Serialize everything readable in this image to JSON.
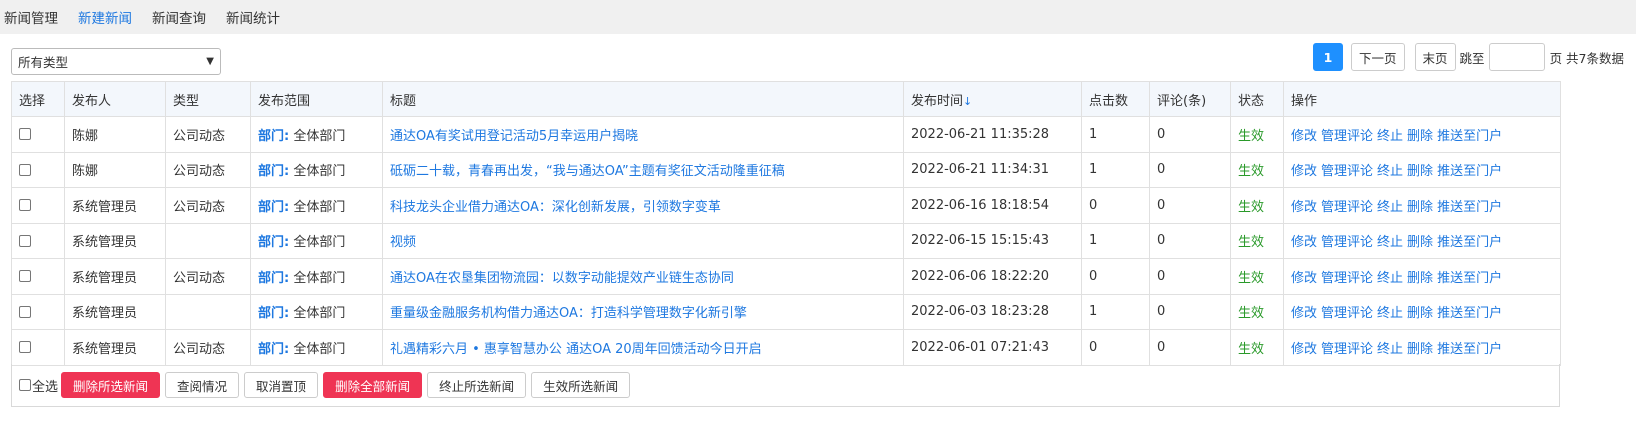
{
  "nav": {
    "items": [
      {
        "label": "新闻管理"
      },
      {
        "label": "新建新闻"
      },
      {
        "label": "新闻查询"
      },
      {
        "label": "新闻统计"
      }
    ]
  },
  "filter": {
    "type_select_value": "所有类型"
  },
  "pager": {
    "current_page": "1",
    "next_label": "下一页",
    "last_label": "末页",
    "jump_prefix": "跳至",
    "jump_suffix": "页 共7条数据",
    "jump_value": ""
  },
  "table": {
    "headers": {
      "select": "选择",
      "publisher": "发布人",
      "type": "类型",
      "scope": "发布范围",
      "title": "标题",
      "time": "发布时间",
      "time_sort": "↓",
      "clicks": "点击数",
      "comments": "评论(条)",
      "status": "状态",
      "ops": "操作"
    },
    "scope_prefix": "部门:",
    "op_labels": {
      "edit": "修改",
      "manage_comments": "管理评论",
      "stop": "终止",
      "delete": "删除",
      "push": "推送至门户"
    },
    "rows": [
      {
        "publisher": "陈娜",
        "type": "公司动态",
        "scope": "全体部门",
        "title": "通达OA有奖试用登记活动5月幸运用户揭晓",
        "time": "2022-06-21 11:35:28",
        "clicks": "1",
        "comments": "0",
        "status": "生效"
      },
      {
        "publisher": "陈娜",
        "type": "公司动态",
        "scope": "全体部门",
        "title": "砥砺二十载，青春再出发，“我与通达OA”主题有奖征文活动隆重征稿",
        "time": "2022-06-21 11:34:31",
        "clicks": "1",
        "comments": "0",
        "status": "生效"
      },
      {
        "publisher": "系统管理员",
        "type": "公司动态",
        "scope": "全体部门",
        "title": "科技龙头企业借力通达OA：深化创新发展，引领数字变革",
        "time": "2022-06-16 18:18:54",
        "clicks": "0",
        "comments": "0",
        "status": "生效"
      },
      {
        "publisher": "系统管理员",
        "type": "",
        "scope": "全体部门",
        "title": "视频",
        "time": "2022-06-15 15:15:43",
        "clicks": "1",
        "comments": "0",
        "status": "生效"
      },
      {
        "publisher": "系统管理员",
        "type": "公司动态",
        "scope": "全体部门",
        "title": "通达OA在农垦集团物流园：以数字动能提效产业链生态协同",
        "time": "2022-06-06 18:22:20",
        "clicks": "0",
        "comments": "0",
        "status": "生效"
      },
      {
        "publisher": "系统管理员",
        "type": "",
        "scope": "全体部门",
        "title": "重量级金融服务机构借力通达OA：打造科学管理数字化新引擎",
        "time": "2022-06-03 18:23:28",
        "clicks": "1",
        "comments": "0",
        "status": "生效"
      },
      {
        "publisher": "系统管理员",
        "type": "公司动态",
        "scope": "全体部门",
        "title": "礼遇精彩六月 • 惠享智慧办公 通达OA 20周年回馈活动今日开启",
        "time": "2022-06-01 07:21:43",
        "clicks": "0",
        "comments": "0",
        "status": "生效"
      }
    ]
  },
  "footer": {
    "select_all": "全选",
    "buttons": {
      "delete_selected": "删除所选新闻",
      "view_reading": "查阅情况",
      "cancel_top": "取消置顶",
      "delete_all": "删除全部新闻",
      "stop_selected": "终止所选新闻",
      "activate_selected": "生效所选新闻"
    }
  },
  "colors": {
    "accent": "#1e78e0",
    "danger": "#ef3454",
    "status_ok": "#2a9a2a",
    "pager_active": "#1e90ff"
  }
}
